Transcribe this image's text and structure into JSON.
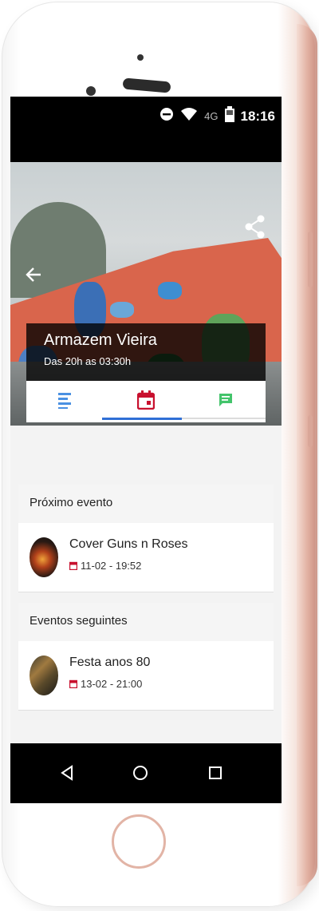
{
  "statusbar": {
    "network": "4G",
    "time": "18:16"
  },
  "venue": {
    "name": "Armazem Vieira",
    "hours": "Das 20h as 03:30h"
  },
  "tabs": [
    {
      "icon": "list-icon",
      "color": "#4a90e2"
    },
    {
      "icon": "calendar-icon",
      "color": "#c8102e",
      "active": true
    },
    {
      "icon": "chat-icon",
      "color": "#43c46b"
    }
  ],
  "next_event": {
    "header": "Próximo evento",
    "name": "Cover Guns n Roses",
    "date": "11-02 - 19:52"
  },
  "following_events": {
    "header": "Eventos seguintes",
    "items": [
      {
        "name": "Festa anos 80",
        "date": "13-02 - 21:00"
      }
    ]
  },
  "colors": {
    "accent_blue": "#2f6fd6",
    "calendar_red": "#c8102e",
    "chat_green": "#43c46b"
  }
}
